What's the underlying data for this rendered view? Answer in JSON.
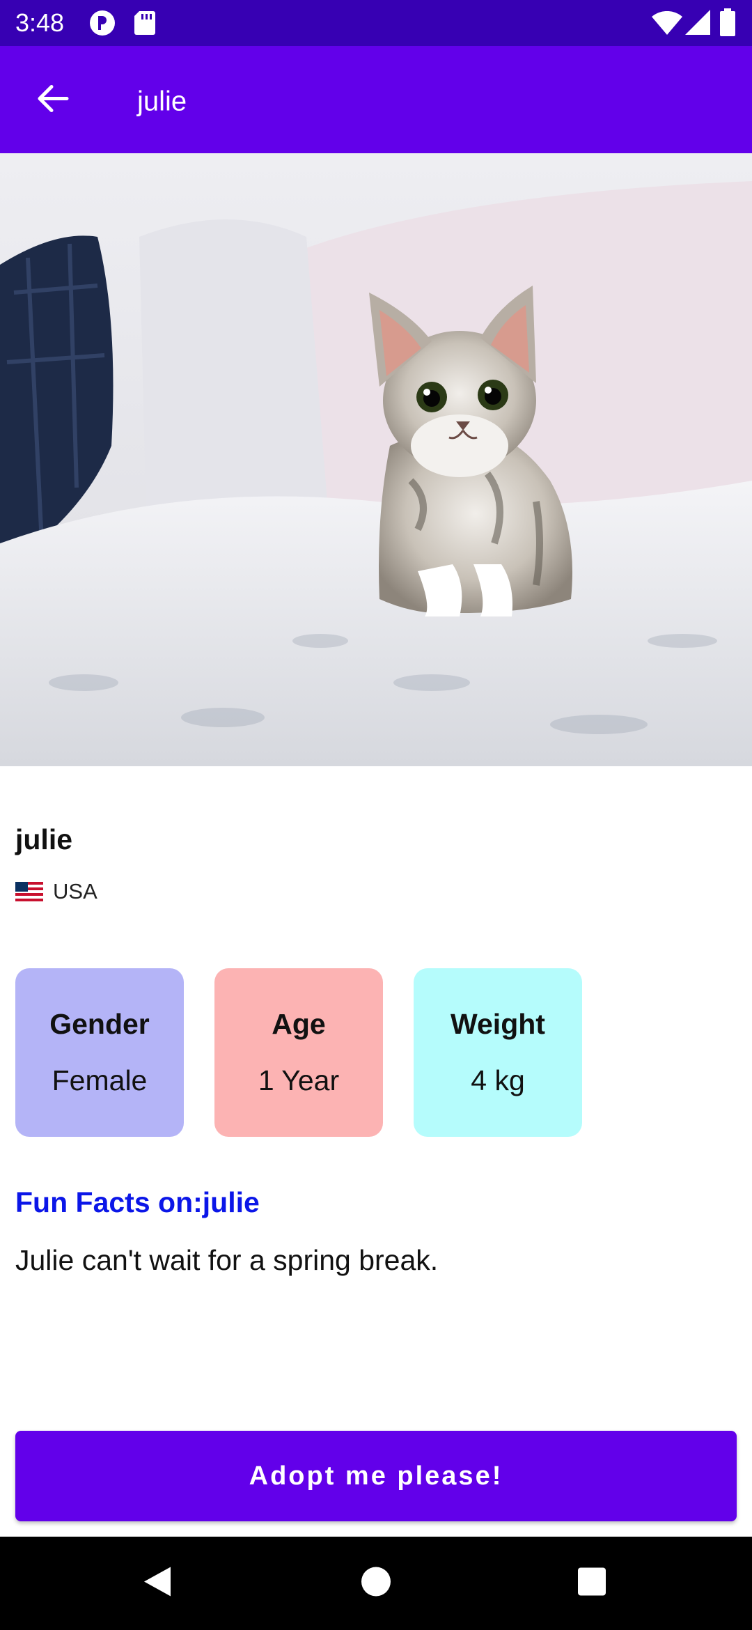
{
  "status_bar": {
    "time": "3:48",
    "icons": [
      "notification-app-icon",
      "sd-card-icon",
      "wifi-icon",
      "signal-icon",
      "battery-icon"
    ]
  },
  "app_bar": {
    "title": "julie",
    "back_icon": "arrow-left-icon",
    "color": "#6200ea"
  },
  "hero_image": {
    "subject": "kitten-on-bed-photo"
  },
  "pet": {
    "name": "julie",
    "country": "USA",
    "flag_icon": "us-flag-icon"
  },
  "stats": {
    "gender": {
      "label": "Gender",
      "value": "Female",
      "color": "#b4b4f7"
    },
    "age": {
      "label": "Age",
      "value": "1 Year",
      "color": "#fcb3b3"
    },
    "weight": {
      "label": "Weight",
      "value": "4 kg",
      "color": "#b5fcfc"
    }
  },
  "fun_facts": {
    "title": "Fun Facts on:julie",
    "text": "Julie can't wait for a spring break.",
    "title_color": "#0b16e8"
  },
  "adopt_button": {
    "label": "Adopt me please!"
  },
  "nav_bar": {
    "icons": [
      "back-triangle-icon",
      "home-circle-icon",
      "recents-square-icon"
    ]
  }
}
